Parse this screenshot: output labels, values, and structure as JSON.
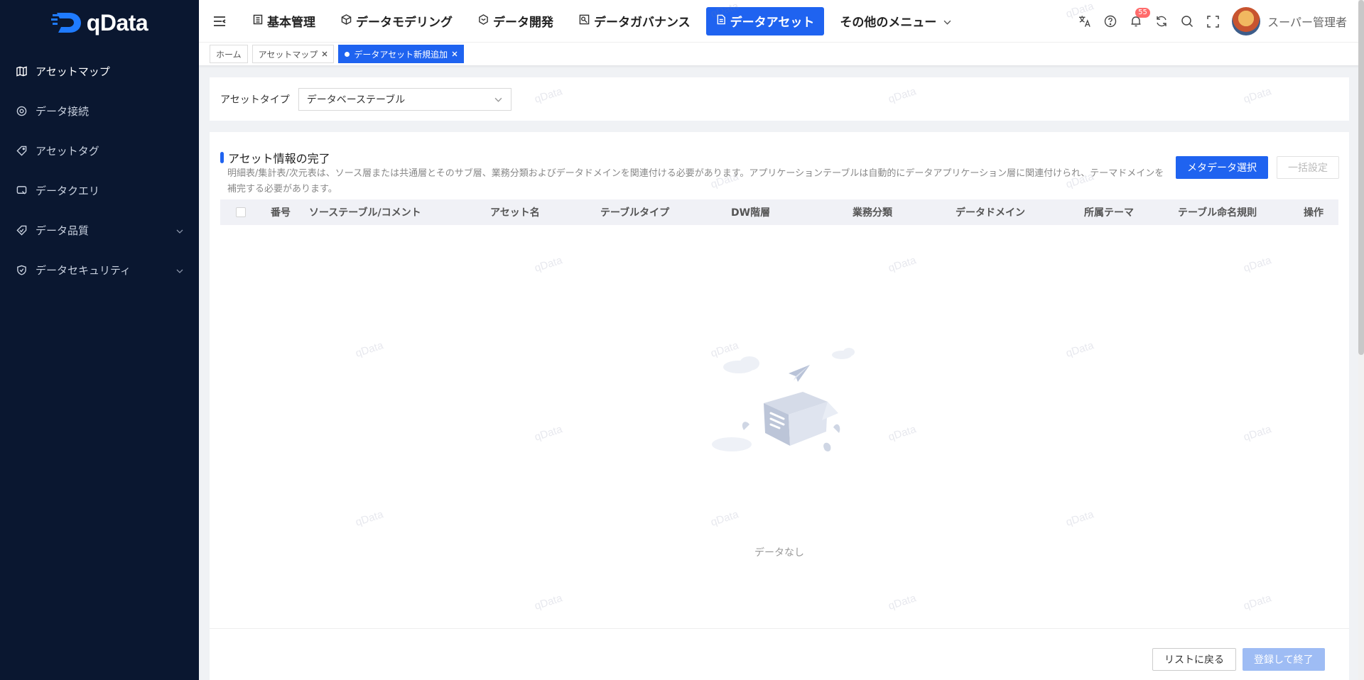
{
  "app": {
    "name": "qData"
  },
  "sidebar": {
    "items": [
      {
        "label": "アセットマップ",
        "icon": "map-icon"
      },
      {
        "label": "データ接続",
        "icon": "target-icon"
      },
      {
        "label": "アセットタグ",
        "icon": "tag-icon"
      },
      {
        "label": "データクエリ",
        "icon": "query-icon"
      },
      {
        "label": "データ品質",
        "icon": "quality-icon"
      },
      {
        "label": "データセキュリティ",
        "icon": "shield-icon"
      }
    ]
  },
  "header": {
    "menus": [
      {
        "label": "基本管理",
        "icon": "building-icon"
      },
      {
        "label": "データモデリング",
        "icon": "cube-icon"
      },
      {
        "label": "データ開発",
        "icon": "hexagon-icon"
      },
      {
        "label": "データガバナンス",
        "icon": "governance-icon"
      },
      {
        "label": "データアセット",
        "icon": "document-icon"
      },
      {
        "label": "その他のメニュー",
        "icon": "chevron-down-icon"
      }
    ],
    "badge_count": "55",
    "username": "スーパー管理者"
  },
  "tabs": [
    {
      "label": "ホーム"
    },
    {
      "label": "アセットマップ"
    },
    {
      "label": "データアセット新規追加"
    }
  ],
  "filter": {
    "label": "アセットタイプ",
    "value": "データベーステーブル"
  },
  "section": {
    "title": "アセット情報の完了",
    "description": "明細表/集計表/次元表は、ソース層または共通層とそのサブ層、業務分類およびデータドメインを関連付ける必要があります。アプリケーションテーブルは自動的にデータアプリケーション層に関連付けられ、テーマドメインを補完する必要があります。",
    "select_metadata": "メタデータ選択",
    "bulk_set": "一括設定"
  },
  "table": {
    "columns": [
      "番号",
      "ソーステーブル/コメント",
      "アセット名",
      "テーブルタイプ",
      "DW階層",
      "業務分類",
      "データドメイン",
      "所属テーマ",
      "テーブル命名規則",
      "操作"
    ],
    "empty_text": "データなし"
  },
  "footer": {
    "back_label": "リストに戻る",
    "finish_label": "登録して終了"
  },
  "watermark": "qData",
  "colors": {
    "accent": "#1f63f0",
    "sidebar_bg": "#0a1730"
  }
}
